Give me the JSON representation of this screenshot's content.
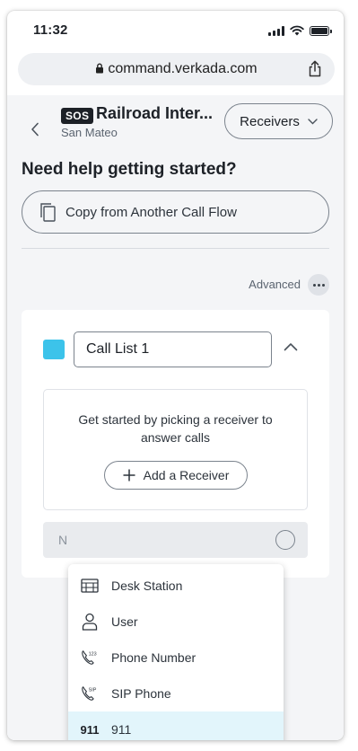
{
  "status_bar": {
    "time": "11:32"
  },
  "browser": {
    "url": "command.verkada.com"
  },
  "header": {
    "badge": "SOS",
    "title": "Railroad Inter...",
    "subtitle": "San Mateo",
    "receivers_label": "Receivers"
  },
  "getting_started": {
    "heading": "Need help getting started?",
    "copy_button": "Copy from Another Call Flow"
  },
  "advanced": {
    "label": "Advanced"
  },
  "call_list": {
    "name_value": "Call List 1",
    "swatch_color": "#3cc3ea",
    "empty_text": "Get started by picking a receiver to answer calls",
    "add_receiver_label": "Add a Receiver",
    "bottom_bar_partial": "N"
  },
  "receiver_menu": {
    "items": [
      {
        "icon": "desk-station-icon",
        "label": "Desk Station"
      },
      {
        "icon": "user-icon",
        "label": "User"
      },
      {
        "icon": "phone-number-icon",
        "label": "Phone Number",
        "icon_text": "123"
      },
      {
        "icon": "sip-phone-icon",
        "label": "SIP Phone",
        "icon_text": "SIP"
      },
      {
        "icon": "911-icon",
        "label": "911",
        "icon_text": "911",
        "selected": true
      }
    ]
  },
  "colors": {
    "accent": "#3cc3ea",
    "selected_row": "#e2f5fb"
  }
}
